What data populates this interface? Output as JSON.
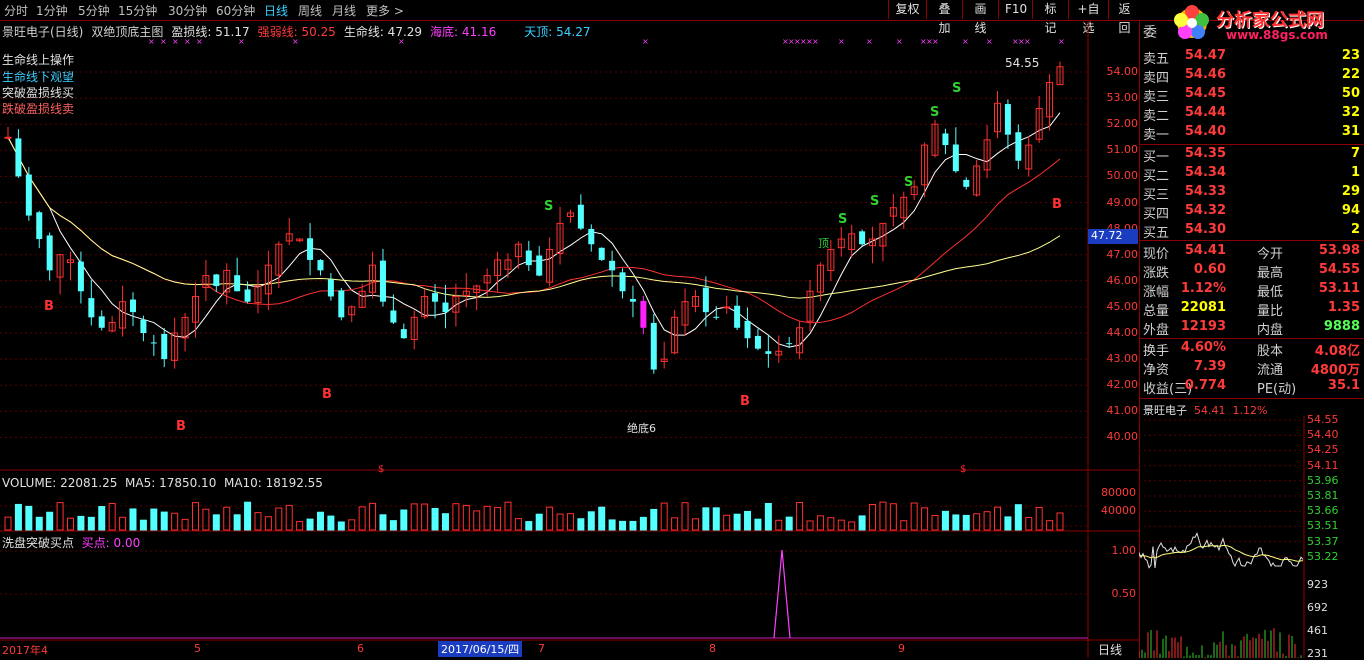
{
  "toolbar": {
    "timeframes": [
      "分时",
      "1分钟",
      "5分钟",
      "15分钟",
      "30分钟",
      "60分钟",
      "日线",
      "周线",
      "月线",
      "更多 >"
    ],
    "active_index": 6,
    "buttons": [
      "复权",
      "叠加",
      "画线",
      "F10",
      "标记",
      "+自选",
      "返回"
    ]
  },
  "header": {
    "stock": "景旺电子(日线)",
    "indicator_name": "双绝顶底主图",
    "profit_line": "盈损线: 51.17",
    "strong_weak": "强弱线: 50.25",
    "life_line": "生命线: 47.29",
    "sea_bottom": "海底: 41.16",
    "sky_top": "天顶: 54.27"
  },
  "signals": {
    "line1": "生命线上操作",
    "line2": "生命线下观望",
    "line3": "突破盈损线买",
    "line4": "跌破盈损线卖",
    "high_label": "54.55",
    "bottom_label": "绝底6",
    "ding_label": "顶",
    "price_tag": "47.72"
  },
  "yaxis_main": [
    "54.00",
    "53.00",
    "52.00",
    "51.00",
    "50.00",
    "49.00",
    "48.00",
    "47.00",
    "46.00",
    "45.00",
    "44.00",
    "43.00",
    "42.00",
    "41.00",
    "40.00"
  ],
  "volume": {
    "label": "VOLUME: 22081.25",
    "ma5": "MA5: 17850.10",
    "ma10": "MA10: 18192.55",
    "ticks": [
      "80000",
      "40000"
    ]
  },
  "sub": {
    "label": "洗盘突破买点",
    "buy": "买点: 0.00",
    "ticks": [
      "1.00",
      "0.50"
    ]
  },
  "xaxis": {
    "labels": [
      "2017年4",
      "5",
      "6",
      "2017/06/15/四",
      "7",
      "8",
      "9"
    ],
    "period": "日线"
  },
  "orderbook": {
    "title": "委",
    "sells": [
      {
        "k": "卖五",
        "p": "54.47",
        "q": "23"
      },
      {
        "k": "卖四",
        "p": "54.46",
        "q": "22"
      },
      {
        "k": "卖三",
        "p": "54.45",
        "q": "50"
      },
      {
        "k": "卖二",
        "p": "54.44",
        "q": "32"
      },
      {
        "k": "卖一",
        "p": "54.40",
        "q": "31"
      }
    ],
    "buys": [
      {
        "k": "买一",
        "p": "54.35",
        "q": "7"
      },
      {
        "k": "买二",
        "p": "54.34",
        "q": "1"
      },
      {
        "k": "买三",
        "p": "54.33",
        "q": "29"
      },
      {
        "k": "买四",
        "p": "54.32",
        "q": "94"
      },
      {
        "k": "买五",
        "p": "54.30",
        "q": "2"
      }
    ]
  },
  "quote": [
    {
      "k": "现价",
      "v": "54.41",
      "k2": "今开",
      "v2": "53.98"
    },
    {
      "k": "涨跌",
      "v": "0.60",
      "k2": "最高",
      "v2": "54.55"
    },
    {
      "k": "涨幅",
      "v": "1.12%",
      "k2": "最低",
      "v2": "53.11"
    },
    {
      "k": "总量",
      "v": "22081",
      "k2": "量比",
      "v2": "1.35"
    },
    {
      "k": "外盘",
      "v": "12193",
      "k2": "内盘",
      "v2": "9888"
    }
  ],
  "stats": [
    {
      "k": "换手",
      "v": "4.60%",
      "k2": "股本",
      "v2": "4.08亿"
    },
    {
      "k": "净资",
      "v": "7.39",
      "k2": "流通",
      "v2": "4800万"
    },
    {
      "k": "收益(三)",
      "v": "0.774",
      "k2": "PE(动)",
      "v2": "35.1"
    }
  ],
  "mini": {
    "title": "景旺电子",
    "price": "54.41",
    "pct": "1.12%",
    "ticks": [
      "54.55",
      "54.40",
      "54.25",
      "54.11",
      "53.96",
      "53.81",
      "53.66",
      "53.51",
      "53.37",
      "53.22"
    ],
    "vol_ticks": [
      "923",
      "692",
      "461",
      "231"
    ]
  },
  "watermark": {
    "brand": "分析家公式网",
    "url": "www.88gs.com"
  }
}
